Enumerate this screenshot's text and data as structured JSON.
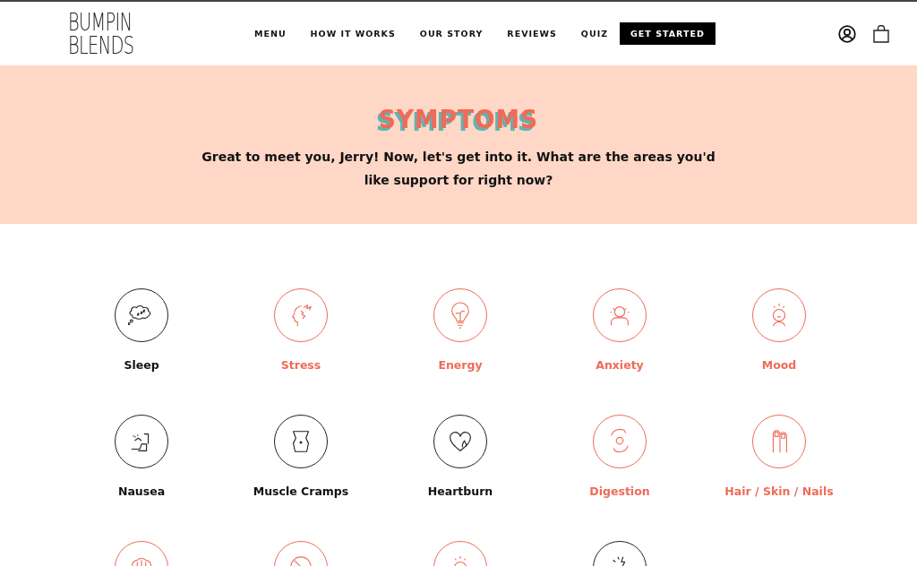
{
  "header": {
    "logo": [
      "BUMPIN",
      "BLENDS"
    ],
    "nav": [
      "MENU",
      "HOW IT WORKS",
      "OUR STORY",
      "REVIEWS",
      "QUIZ"
    ],
    "cta": "GET STARTED"
  },
  "hero": {
    "title": "SYMPTOMS",
    "text": "Great to meet you, Jerry! Now, let's get into it. What are the areas you'd like support for right now?"
  },
  "symptoms": [
    {
      "label": "Sleep",
      "selected": false
    },
    {
      "label": "Stress",
      "selected": true
    },
    {
      "label": "Energy",
      "selected": true
    },
    {
      "label": "Anxiety",
      "selected": true
    },
    {
      "label": "Mood",
      "selected": true
    },
    {
      "label": "Nausea",
      "selected": false
    },
    {
      "label": "Muscle Cramps",
      "selected": false
    },
    {
      "label": "Heartburn",
      "selected": false
    },
    {
      "label": "Digestion",
      "selected": true
    },
    {
      "label": "Hair / Skin / Nails",
      "selected": true
    },
    {
      "selected": true
    },
    {
      "selected": true
    },
    {
      "selected": true
    },
    {
      "selected": false
    }
  ]
}
